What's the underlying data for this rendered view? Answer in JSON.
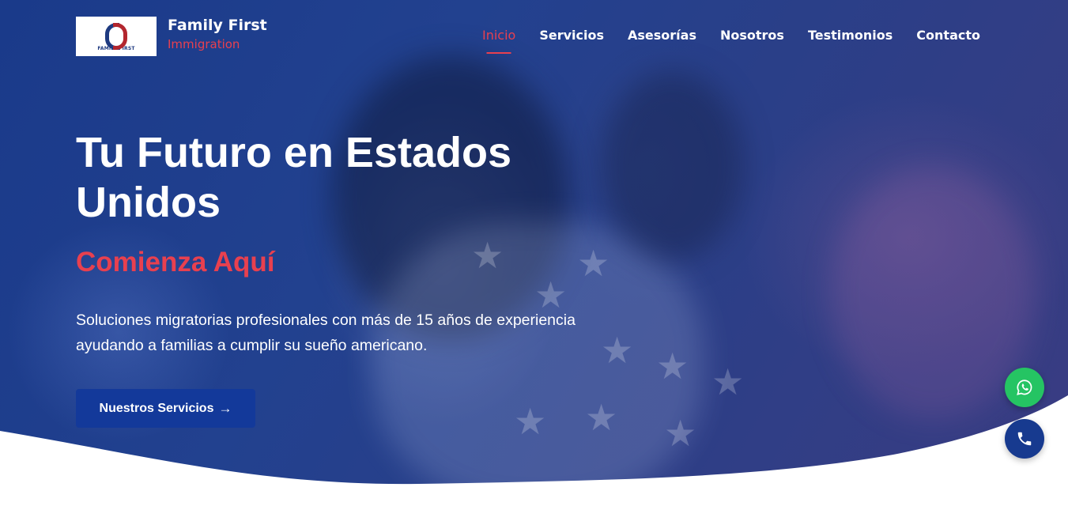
{
  "brand": {
    "logo_text": "FAMILY FIRST",
    "name": "Family First",
    "subname": "Immigration"
  },
  "nav": {
    "items": [
      {
        "label": "Inicio",
        "active": true
      },
      {
        "label": "Servicios",
        "active": false
      },
      {
        "label": "Asesorías",
        "active": false
      },
      {
        "label": "Nosotros",
        "active": false
      },
      {
        "label": "Testimonios",
        "active": false
      },
      {
        "label": "Contacto",
        "active": false
      }
    ]
  },
  "hero": {
    "title": "Tu Futuro en Estados Unidos",
    "subtitle": "Comienza Aquí",
    "description": "Soluciones migratorias profesionales con más de 15 años de experiencia ayudando a familias a cumplir su sueño americano.",
    "cta_label": "Nuestros Servicios",
    "cta_icon": "arrow-right-icon"
  },
  "floating_buttons": {
    "whatsapp_icon": "whatsapp-icon",
    "phone_icon": "phone-icon"
  },
  "colors": {
    "accent": "#e8404f",
    "primary": "#13399a",
    "whatsapp": "#25c463",
    "hero_overlay": "#22418f"
  }
}
